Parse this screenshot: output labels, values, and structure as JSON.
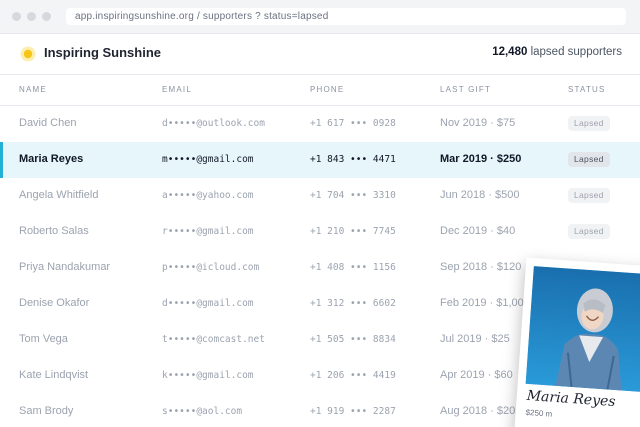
{
  "browser": {
    "url": "app.inspiringsunshine.org / supporters ? status=lapsed"
  },
  "app": {
    "name": "Inspiring Sunshine",
    "count": "12,480",
    "count_suffix": "lapsed supporters"
  },
  "columns": [
    "NAME",
    "EMAIL",
    "PHONE",
    "LAST GIFT",
    "STATUS"
  ],
  "rows": [
    {
      "name": "David Chen",
      "email": "d•••••@outlook.com",
      "phone": "+1 617 ••• 0928",
      "gift": "Nov 2019 · $75",
      "status": "Lapsed"
    },
    {
      "name": "Maria Reyes",
      "email": "m•••••@gmail.com",
      "phone": "+1 843 ••• 4471",
      "gift": "Mar 2019 · $250",
      "status": "Lapsed"
    },
    {
      "name": "Angela Whitfield",
      "email": "a•••••@yahoo.com",
      "phone": "+1 704 ••• 3310",
      "gift": "Jun 2018 · $500",
      "status": "Lapsed"
    },
    {
      "name": "Roberto Salas",
      "email": "r•••••@gmail.com",
      "phone": "+1 210 ••• 7745",
      "gift": "Dec 2019 · $40",
      "status": "Lapsed"
    },
    {
      "name": "Priya Nandakumar",
      "email": "p•••••@icloud.com",
      "phone": "+1 408 ••• 1156",
      "gift": "Sep 2018 · $120",
      "status": ""
    },
    {
      "name": "Denise Okafor",
      "email": "d•••••@gmail.com",
      "phone": "+1 312 ••• 6602",
      "gift": "Feb 2019 · $1,000",
      "status": ""
    },
    {
      "name": "Tom Vega",
      "email": "t•••••@comcast.net",
      "phone": "+1 505 ••• 8834",
      "gift": "Jul 2019 · $25",
      "status": ""
    },
    {
      "name": "Kate Lindqvist",
      "email": "k•••••@gmail.com",
      "phone": "+1 206 ••• 4419",
      "gift": "Apr 2019 · $60",
      "status": ""
    },
    {
      "name": "Sam Brody",
      "email": "s•••••@aol.com",
      "phone": "+1 919 ••• 2287",
      "gift": "Aug 2018 · $20",
      "status": ""
    }
  ],
  "polaroid": {
    "signature": "Maria Reyes",
    "caption": "$250 m"
  },
  "icons": {
    "logo": "sun-icon"
  },
  "colors": {
    "accent": "#22b0d6",
    "selected_row": "#e6f6fb",
    "sun": "#f5c518"
  }
}
